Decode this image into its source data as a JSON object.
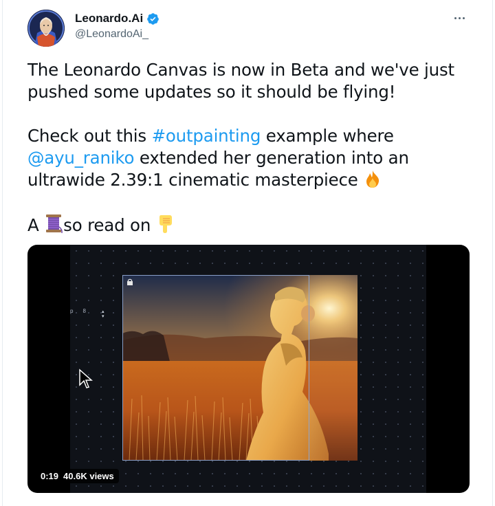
{
  "author": {
    "display_name": "Leonardo.Ai",
    "handle": "@LeonardoAi_",
    "verified": true,
    "avatar_icon": "wizard-avatar-icon"
  },
  "menu": {
    "icon": "more-horizontal-icon"
  },
  "tweet": {
    "line1": "The Leonardo Canvas is now in Beta and we've just pushed some updates so it should be flying!",
    "p2_pre": "Check out this ",
    "hashtag": "#outpainting",
    "p2_mid": " example where ",
    "mention": "@ayu_raniko",
    "p2_post": " extended her generation into an ultrawide 2.39:1 cinematic masterpiece ",
    "p2_emoji": "fire-emoji",
    "p3_a": "A ",
    "p3_thread_emoji": "thread-spool-emoji",
    "p3_b": "so read on ",
    "p3_emoji": "pointing-down-emoji"
  },
  "media": {
    "toolbar_p": "p",
    "toolbar_value": "8",
    "duration": "0:19",
    "views": "40.6K views"
  },
  "colors": {
    "link": "#1d9bf0",
    "verified": "#1d9bf0",
    "secondary_text": "#536471"
  }
}
